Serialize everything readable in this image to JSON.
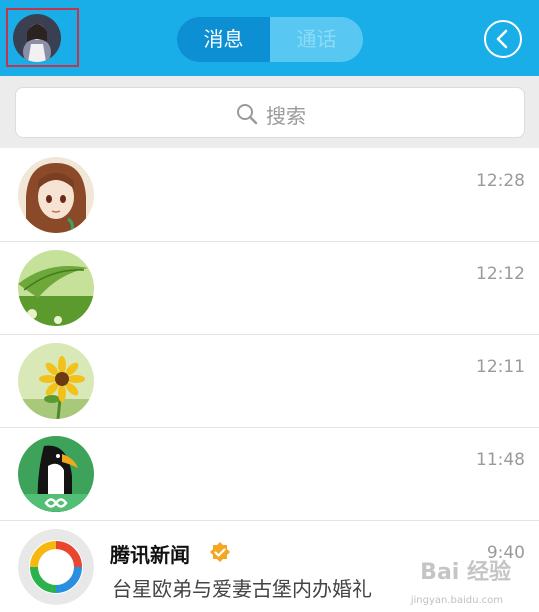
{
  "header": {
    "tabs": [
      {
        "label": "消息",
        "active": true
      },
      {
        "label": "通话",
        "active": false
      }
    ],
    "back_icon": "chevron-left-circle-icon"
  },
  "search": {
    "placeholder": "搜索",
    "icon": "search-icon"
  },
  "chats": [
    {
      "time": "12:28",
      "avatar": "anime-girl-avatar"
    },
    {
      "time": "12:12",
      "avatar": "green-leaf-avatar"
    },
    {
      "time": "12:11",
      "avatar": "sunflower-avatar"
    },
    {
      "time": "11:48",
      "avatar": "penguin-avatar"
    },
    {
      "name": "腾讯新闻",
      "preview": "台星欧弟与爱妻古堡内办婚礼",
      "time": "9:40",
      "verified": true,
      "avatar": "tencent-news-logo"
    }
  ],
  "watermark": {
    "text": "Bai 经验",
    "sub": "jingyan.baidu.com"
  },
  "colors": {
    "topbar": "#1aaee8",
    "active_tab": "#0c8fd3",
    "inactive_tab_bg": "#58c8f2",
    "verified": "#f5a623"
  }
}
